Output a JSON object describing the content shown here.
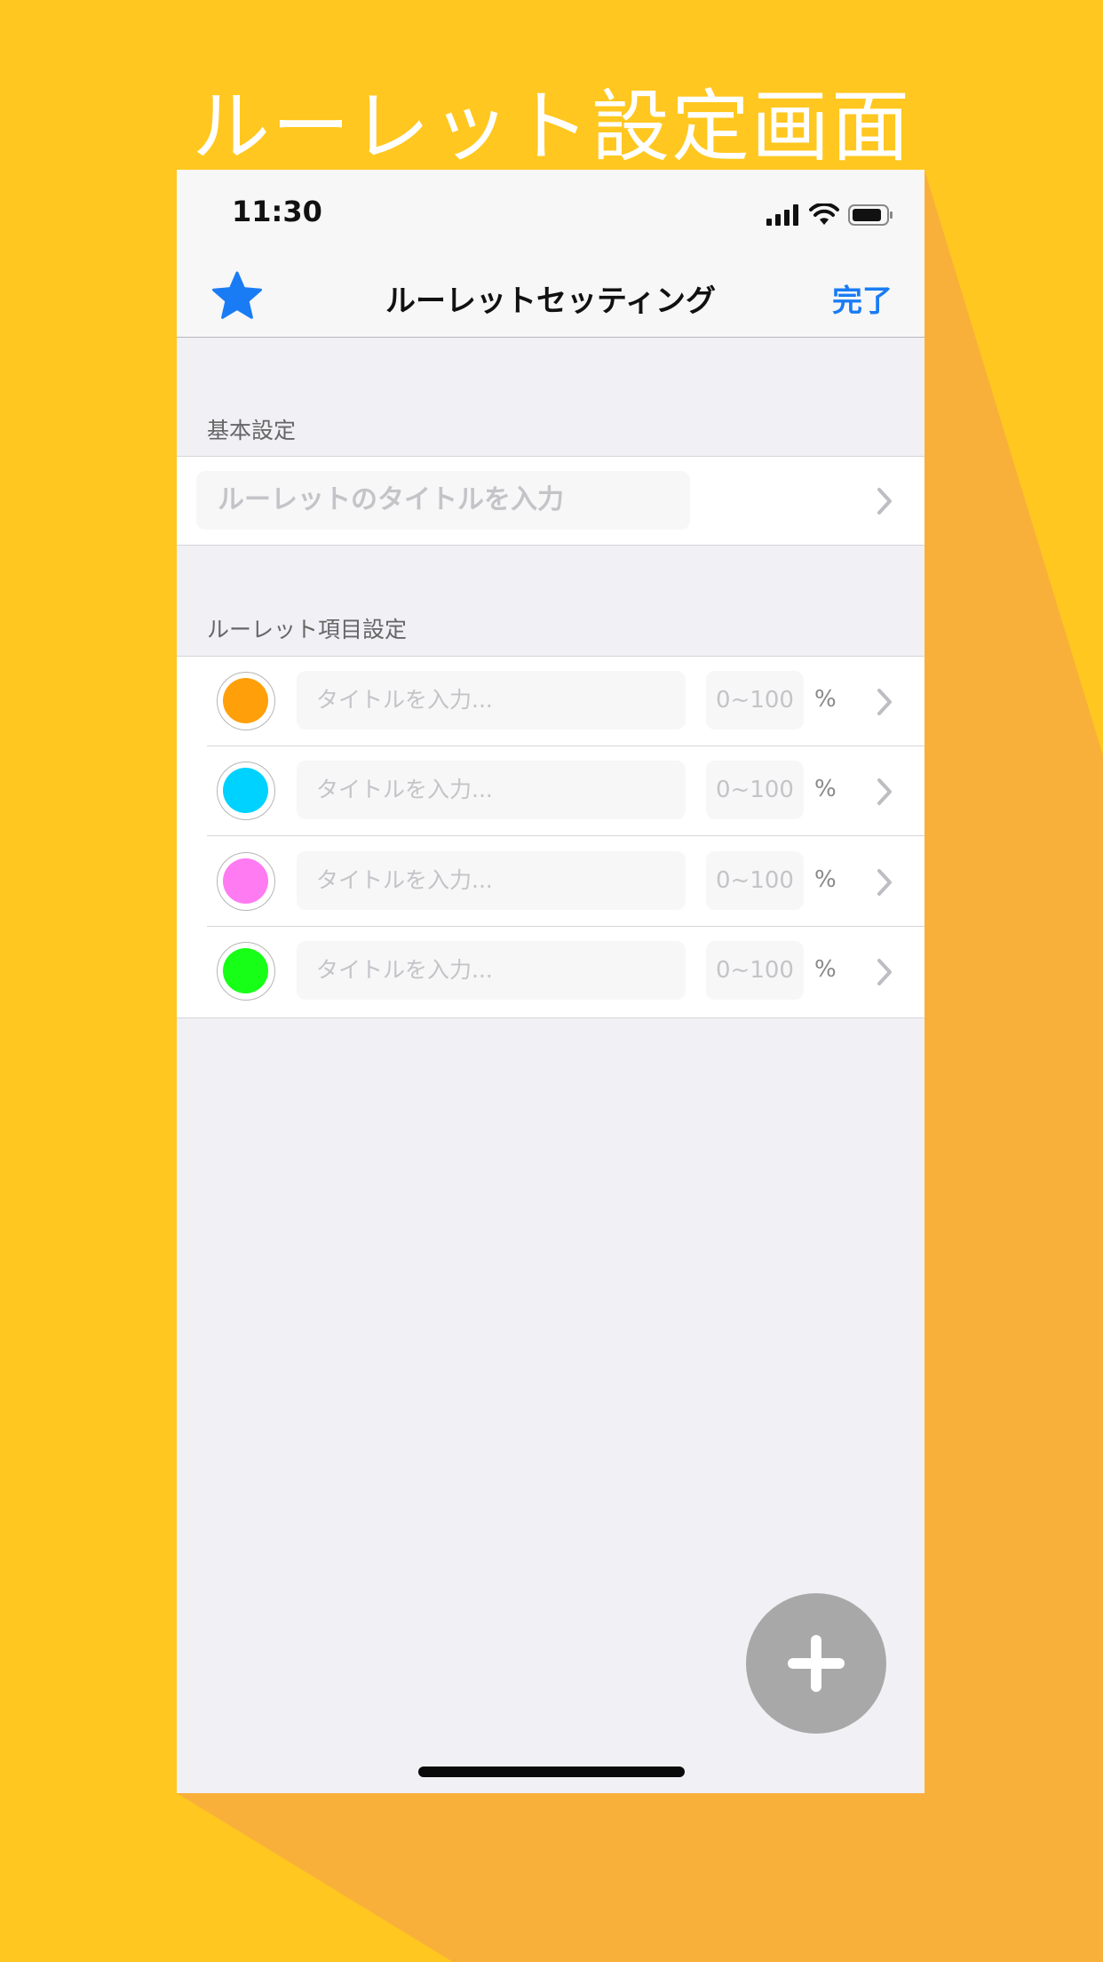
{
  "banner": {
    "title": "ルーレット設定画面"
  },
  "colors": {
    "background": "#FFC71F",
    "shadow": "#F9B03B",
    "accent": "#1A7CF5",
    "fab": "#A8A8A8"
  },
  "status_bar": {
    "time": "11:30",
    "icons": [
      "signal-icon",
      "wifi-icon",
      "battery-icon"
    ]
  },
  "nav": {
    "left_icon": "star-icon",
    "title": "ルーレットセッティング",
    "done_label": "完了"
  },
  "basic_section": {
    "header": "基本設定",
    "title_placeholder": "ルーレットのタイトルを入力"
  },
  "items_section": {
    "header": "ルーレット項目設定",
    "items": [
      {
        "color": "#FF9F0A",
        "title_placeholder": "タイトルを入力...",
        "percent_placeholder": "0~100",
        "unit": "%"
      },
      {
        "color": "#00D2FF",
        "title_placeholder": "タイトルを入力...",
        "percent_placeholder": "0~100",
        "unit": "%"
      },
      {
        "color": "#FF7BF2",
        "title_placeholder": "タイトルを入力...",
        "percent_placeholder": "0~100",
        "unit": "%"
      },
      {
        "color": "#17FF17",
        "title_placeholder": "タイトルを入力...",
        "percent_placeholder": "0~100",
        "unit": "%"
      }
    ]
  },
  "fab": {
    "icon": "plus-icon"
  }
}
